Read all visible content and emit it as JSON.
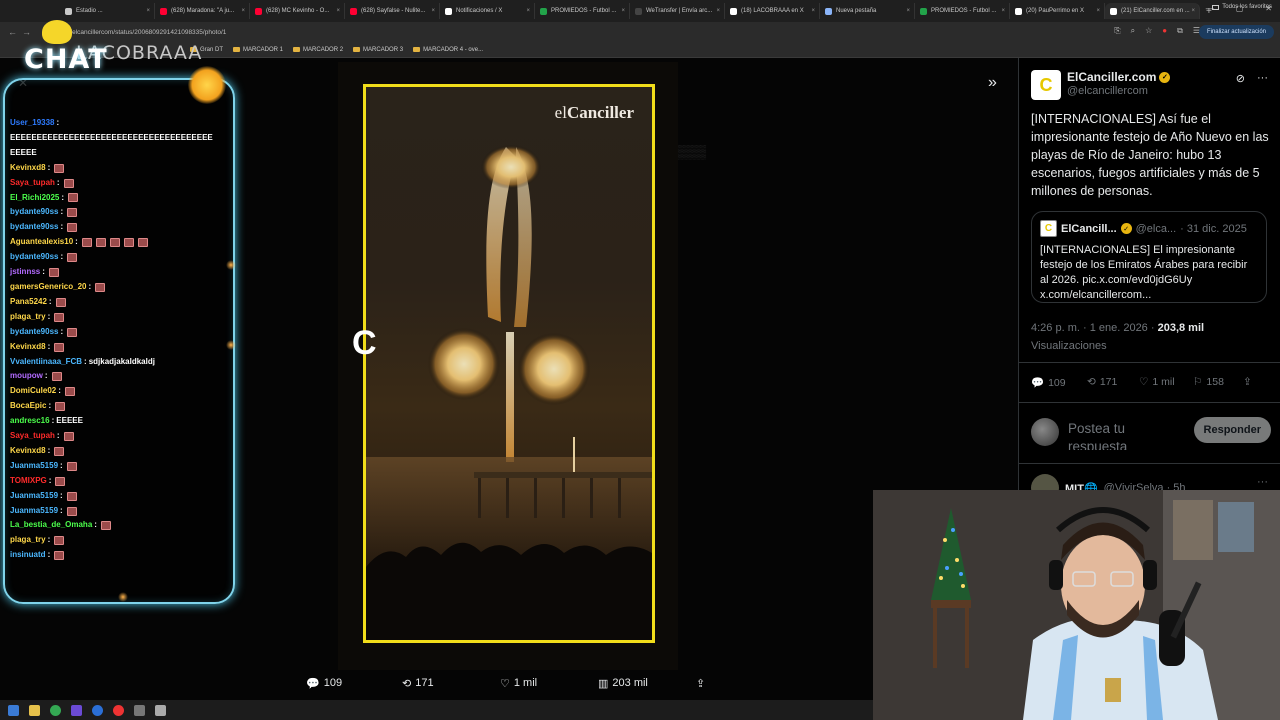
{
  "browser": {
    "tabs": [
      {
        "label": "Estadio ...",
        "color": "#c9c9c9"
      },
      {
        "label": "(628) Maradona: \"A ju...",
        "color": "#ff0033"
      },
      {
        "label": "(628) MC Kevinho - O...",
        "color": "#ff0033"
      },
      {
        "label": "(628) Sayfalse - Nulite...",
        "color": "#ff0033"
      },
      {
        "label": "Notificaciones / X",
        "color": "#ffffff"
      },
      {
        "label": "PROMIEDOS - Futbol ...",
        "color": "#22a34a"
      },
      {
        "label": "WeTransfer | Envía arc...",
        "color": "#444444"
      },
      {
        "label": "(18) LACOBRAAA en X",
        "color": "#ffffff"
      },
      {
        "label": "Nueva pestaña",
        "color": "#8ab4f8"
      },
      {
        "label": "PROMIEDOS - Futbol ...",
        "color": "#22a34a"
      },
      {
        "label": "(20) PauPerrimo en X",
        "color": "#ffffff"
      },
      {
        "label": "(21) ElCanciller.com en ...",
        "color": "#ffffff",
        "active": true
      }
    ],
    "url": "com/elcancillercom/status/2006809291421098335/photo/1",
    "update_button": "Finalizar actualización",
    "bookmarks": [
      "Gran DT",
      "MARCADOR 1",
      "MARCADOR 2",
      "MARCADOR 3",
      "MARCADOR 4 - ove..."
    ],
    "all_bookmarks": "Todos los favoritos"
  },
  "chat": {
    "title": "CHAT",
    "logo_text": "LACOBRAAA",
    "lines": [
      {
        "user": "User_19338",
        "color": "#2e7bff",
        "msg": "",
        "emotes": 0
      },
      {
        "user": "",
        "color": "#ffffff",
        "msg": "EEEEEEEEEEEEEEEEEEEEEEEEEEEEEEEEEEEEEE",
        "emotes": 0
      },
      {
        "user": "",
        "color": "#ffffff",
        "msg": "EEEEE",
        "emotes": 0
      },
      {
        "user": "Kevinxd8",
        "color": "#ffd84a",
        "msg": "",
        "emotes": 1
      },
      {
        "user": "Saya_tupah",
        "color": "#ff2b2b",
        "msg": "",
        "emotes": 1
      },
      {
        "user": "El_Richi2025",
        "color": "#4cff4c",
        "msg": "",
        "emotes": 1
      },
      {
        "user": "bydante90ss",
        "color": "#4cb8ff",
        "msg": "",
        "emotes": 1
      },
      {
        "user": "bydante90ss",
        "color": "#4cb8ff",
        "msg": "",
        "emotes": 1
      },
      {
        "user": "Aguantealexis10",
        "color": "#ffd84a",
        "msg": "",
        "emotes": 5
      },
      {
        "user": "bydante90ss",
        "color": "#4cb8ff",
        "msg": "",
        "emotes": 1
      },
      {
        "user": "jstinnss",
        "color": "#b36bff",
        "msg": "",
        "emotes": 1
      },
      {
        "user": "gamersGenerico_20",
        "color": "#ffd84a",
        "msg": "",
        "emotes": 1
      },
      {
        "user": "Pana5242",
        "color": "#ffd84a",
        "msg": "",
        "emotes": 1
      },
      {
        "user": "plaga_try",
        "color": "#ffd84a",
        "msg": "",
        "emotes": 1
      },
      {
        "user": "bydante90ss",
        "color": "#4cb8ff",
        "msg": "",
        "emotes": 1
      },
      {
        "user": "Kevinxd8",
        "color": "#ffd84a",
        "msg": "",
        "emotes": 1
      },
      {
        "user": "Vvalentiinaaa_FCB",
        "color": "#4cb8ff",
        "msg": "sdjkadjakaldkaldj",
        "emotes": 0
      },
      {
        "user": "moupow",
        "color": "#b36bff",
        "msg": "",
        "emotes": 1
      },
      {
        "user": "DomiCule02",
        "color": "#ffd84a",
        "msg": "",
        "emotes": 1
      },
      {
        "user": "BocaEpic",
        "color": "#ffd84a",
        "msg": "",
        "emotes": 1
      },
      {
        "user": "andresc16",
        "color": "#4cff4c",
        "msg": "EEEEE",
        "emotes": 0
      },
      {
        "user": "Saya_tupah",
        "color": "#ff2b2b",
        "msg": "",
        "emotes": 1
      },
      {
        "user": "Kevinxd8",
        "color": "#ffd84a",
        "msg": "",
        "emotes": 1
      },
      {
        "user": "Juanma5159",
        "color": "#4cb8ff",
        "msg": "",
        "emotes": 1
      },
      {
        "user": "TOMIXPG",
        "color": "#ff2b2b",
        "msg": "",
        "emotes": 1
      },
      {
        "user": "Juanma5159",
        "color": "#4cb8ff",
        "msg": "",
        "emotes": 1
      },
      {
        "user": "Juanma5159",
        "color": "#4cb8ff",
        "msg": "",
        "emotes": 1
      },
      {
        "user": "La_bestia_de_Omaha",
        "color": "#4cff4c",
        "msg": "",
        "emotes": 1
      },
      {
        "user": "plaga_try",
        "color": "#ffd84a",
        "msg": "",
        "emotes": 1
      },
      {
        "user": "insinuatd",
        "color": "#4cb8ff",
        "msg": "",
        "emotes": 1
      }
    ]
  },
  "media": {
    "watermark_prefix": "el",
    "watermark_brand": "Canciller",
    "overlay_letter": "C"
  },
  "media_actions": {
    "replies": "109",
    "reposts": "171",
    "likes": "1 mil",
    "views": "203 mil"
  },
  "post": {
    "author": "ElCanciller.com",
    "handle": "@elcancillercom",
    "avatar_letter": "C",
    "text": "[INTERNACIONALES] Así fue el impresionante festejo de Año Nuevo en las playas de Río de Janeiro: hubo 13 escenarios, fuegos artificiales y más de 5 millones de personas.",
    "quote": {
      "author": "ElCancill...",
      "handle": "@elca...",
      "date": "· 31 dic. 2025",
      "text": "[INTERNACIONALES] El impresionante festejo de los Emiratos Árabes para recibir al 2026. pic.x.com/evd0jdG6Uy x.com/elcancillercom..."
    },
    "time": "4:26 p. m. · 1 ene. 2026 ·",
    "views_count": "203,8 mil",
    "views_label": "Visualizaciones",
    "stats": {
      "replies": "109",
      "reposts": "171",
      "likes": "1 mil",
      "bookmarks": "158"
    },
    "reply_placeholder": "Postea tu respuesta",
    "reply_button": "Responder",
    "next": {
      "author": "MIT🌐",
      "handle": "@VivirSelva · 5h"
    }
  },
  "colors": {
    "accent_yellow": "#f1dd1a",
    "chat_border": "#7fd3ea",
    "verified": "#e8b510"
  }
}
